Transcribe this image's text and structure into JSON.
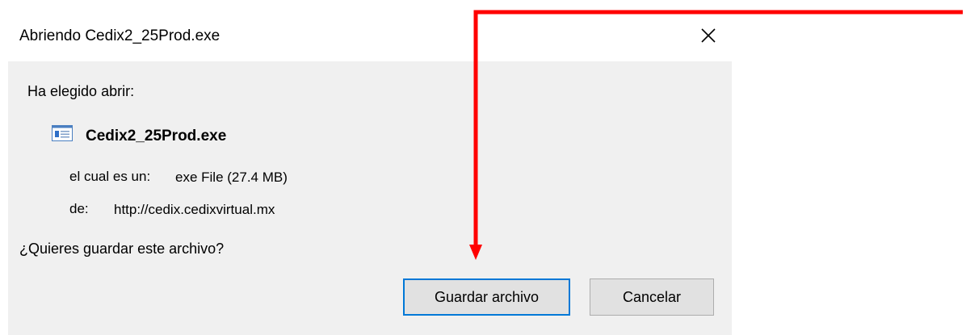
{
  "window": {
    "title": "Abriendo Cedix2_25Prod.exe"
  },
  "dialog": {
    "intro": "Ha elegido abrir:",
    "file_name": "Cedix2_25Prod.exe",
    "type_label": "el cual es un:",
    "type_value": "exe File (27.4 MB)",
    "from_label": "de:",
    "from_value": "http://cedix.cedixvirtual.mx",
    "question": "¿Quieres guardar este archivo?"
  },
  "buttons": {
    "save": "Guardar archivo",
    "cancel": "Cancelar"
  },
  "icons": {
    "file": "exe-file-icon",
    "close": "close-icon"
  },
  "colors": {
    "accent": "#0078d7",
    "annotation_arrow": "#ff0000",
    "dialog_body": "#f0f0f0",
    "button_face": "#e1e1e1"
  }
}
